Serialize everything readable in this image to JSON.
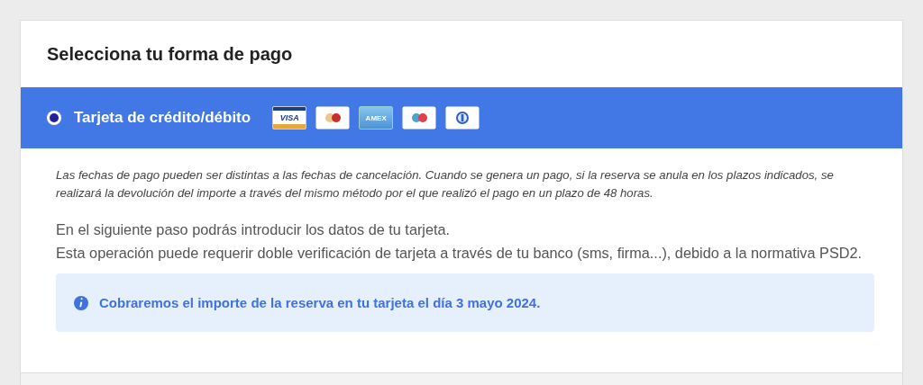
{
  "title": "Selecciona tu forma de pago",
  "payment_option": {
    "label": "Tarjeta de crédito/débito",
    "selected": true,
    "cards": [
      {
        "kind": "visa",
        "label": "VISA"
      },
      {
        "kind": "mastercard"
      },
      {
        "kind": "amex",
        "label": "AMEX"
      },
      {
        "kind": "maestro"
      },
      {
        "kind": "diners"
      }
    ]
  },
  "notice": "Las fechas de pago pueden ser distintas a las fechas de cancelación. Cuando se genera un pago, si la reserva se anula en los plazos indicados, se realizará la devolución del importe a través del mismo método por el que realizó el pago en un plazo de 48 horas.",
  "paragraphs": [
    "En el siguiente paso podrás introducir los datos de tu tarjeta.",
    "Esta operación puede requerir doble verificación de tarjeta a través de tu banco (sms, firma...), debido a la normativa PSD2."
  ],
  "info": "Cobraremos el importe de la reserva en tu tarjeta el día 3 mayo 2024."
}
